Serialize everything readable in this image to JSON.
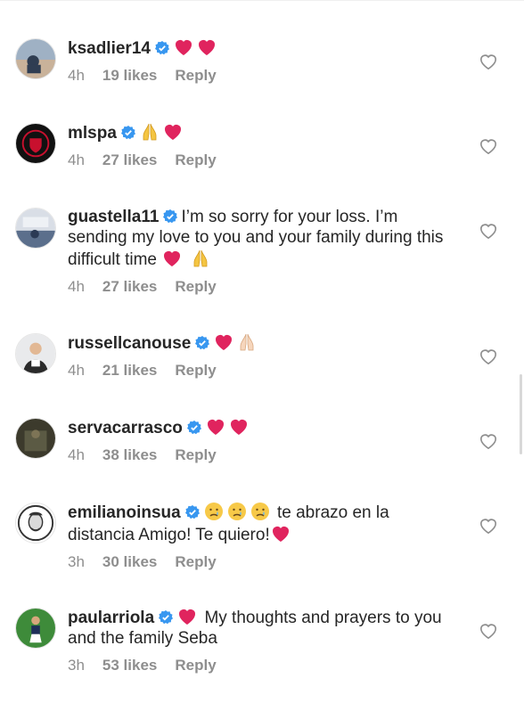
{
  "comments": [
    {
      "username": "ksadlier14",
      "text": "",
      "emojis": [
        "heart-emoji",
        "heart-emoji"
      ],
      "time": "4h",
      "likes": "19 likes",
      "reply": "Reply"
    },
    {
      "username": "mlspa",
      "text": "",
      "emojis": [
        "pray-emoji",
        "heart-emoji"
      ],
      "time": "4h",
      "likes": "27 likes",
      "reply": "Reply"
    },
    {
      "username": "guastella11",
      "text": "I’m so sorry for your loss. I’m sending my love to you and your family during this difficult time",
      "emojis": [
        "heart-emoji",
        "pray-emoji"
      ],
      "time": "4h",
      "likes": "27 likes",
      "reply": "Reply"
    },
    {
      "username": "russellcanouse",
      "text": "",
      "emojis": [
        "heart-emoji",
        "pray-emoji"
      ],
      "time": "4h",
      "likes": "21 likes",
      "reply": "Reply"
    },
    {
      "username": "servacarrasco",
      "text": "",
      "emojis": [
        "heart-emoji",
        "heart-emoji"
      ],
      "time": "4h",
      "likes": "38 likes",
      "reply": "Reply"
    },
    {
      "username": "emilianoinsua",
      "text_before": "te abrazo en la distancia Amigo! Te quiero!",
      "emojis_before": [
        "crying-emoji",
        "crying-emoji",
        "crying-emoji"
      ],
      "emojis": [
        "heart-emoji"
      ],
      "time": "3h",
      "likes": "30 likes",
      "reply": "Reply"
    },
    {
      "username": "paularriola",
      "text_after": "My thoughts and prayers to you and the family Seba",
      "emojis_before": [
        "heart-emoji"
      ],
      "time": "3h",
      "likes": "53 likes",
      "reply": "Reply"
    }
  ],
  "colors": {
    "username": "#262626",
    "meta": "#8e8e8e",
    "verified": "#3897f0",
    "heart": "#e0245e"
  },
  "icons": {
    "verified": "verified-badge-icon",
    "like": "heart-outline-icon"
  }
}
